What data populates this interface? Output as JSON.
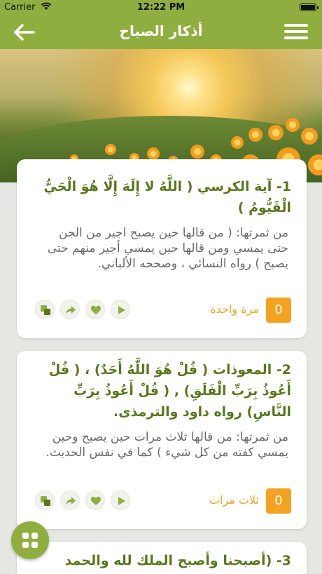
{
  "status_bar": {
    "carrier": "Carrier",
    "time": "12:22 PM"
  },
  "nav": {
    "title": "أذكار الصباح"
  },
  "colors": {
    "accent": "#8fae3f",
    "heading": "#58781d",
    "counter": "#f3a321"
  },
  "cards": [
    {
      "heading": "1- آية الكرسي  ( اللَّهُ لا إِلَهَ إِلَّا هُوَ الْحَيُّ الْقَيُّومُ )",
      "benefit": "من ثمرتها:   ( من قالها حين يصبح اجير من الجن حتى يمسي ومن قالها حين يمسي أجير منهم حتى يصبح )  رواه النسائي ، وصححه الألباني.",
      "count": "0",
      "repeat": "مرة واحدة"
    },
    {
      "heading": "2- المعوذات  ( قُلْ هُوَ اللَّهُ أَحَدٌ)  ، ( قُلْ أَعُوذُ بِرَبِّ الْفَلَقِ)  ,  ( قُلْ أَعُوذُ بِرَبِّ النَّاسِ)  رواه داود والترمذى.",
      "benefit": "من ثمرتها:  من قالها ثلاث مرات حين يصبح وحين يمسي كفته من كل شيء )  كما في نفس الحديث.",
      "count": "0",
      "repeat": "ثلاث مرات"
    },
    {
      "heading": "3-  (أصبحنا وأصبح الملك لله والحمد"
    }
  ]
}
